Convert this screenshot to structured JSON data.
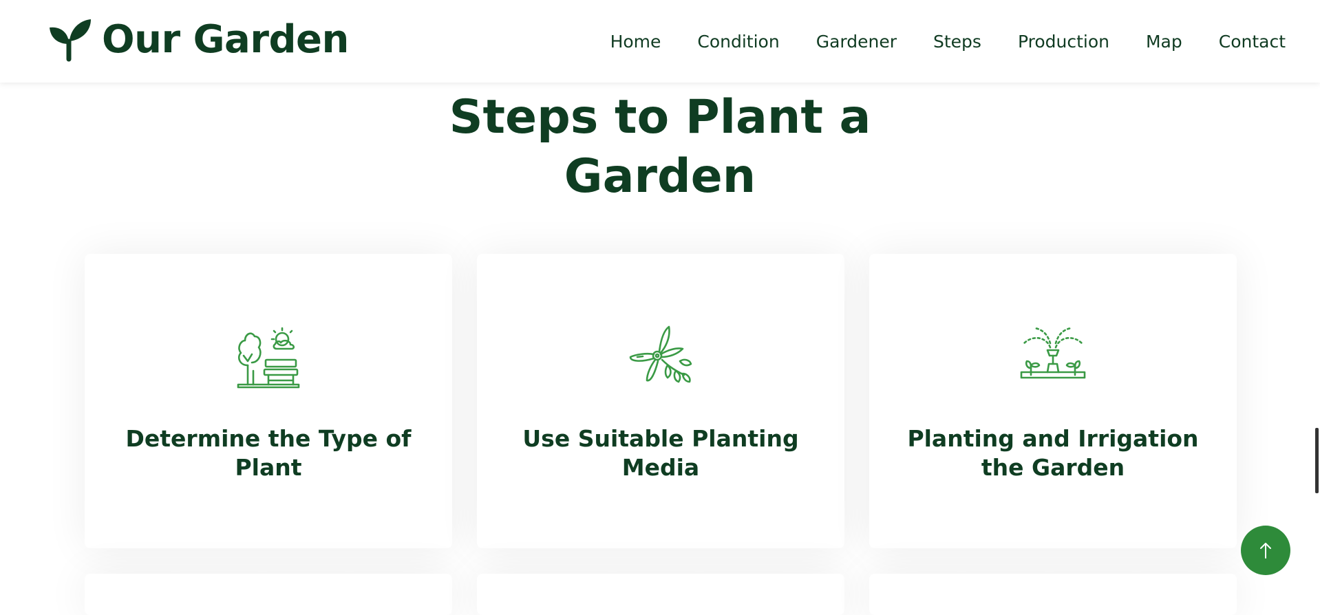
{
  "brand": {
    "name": "Our Garden",
    "icon": "sprout-icon",
    "color": "#0f3d22"
  },
  "nav": {
    "items": [
      {
        "label": "Home"
      },
      {
        "label": "Condition"
      },
      {
        "label": "Gardener"
      },
      {
        "label": "Steps"
      },
      {
        "label": "Production"
      },
      {
        "label": "Map"
      },
      {
        "label": "Contact"
      }
    ]
  },
  "section": {
    "title_line1": "Steps to Plant a",
    "title_line2": "Garden"
  },
  "cards": [
    {
      "icon": "park-tree-bench-icon",
      "title": "Determine the Type of Plant"
    },
    {
      "icon": "pruning-shears-icon",
      "title": "Use Suitable Planting Media"
    },
    {
      "icon": "sprinkler-irrigation-icon",
      "title": "Planting and Irrigation the Garden"
    }
  ],
  "colors": {
    "accent": "#2e8b3a",
    "icon_stroke": "#3a9a45",
    "heading": "#0f3d22"
  },
  "back_to_top": {
    "icon": "arrow-up-icon"
  }
}
